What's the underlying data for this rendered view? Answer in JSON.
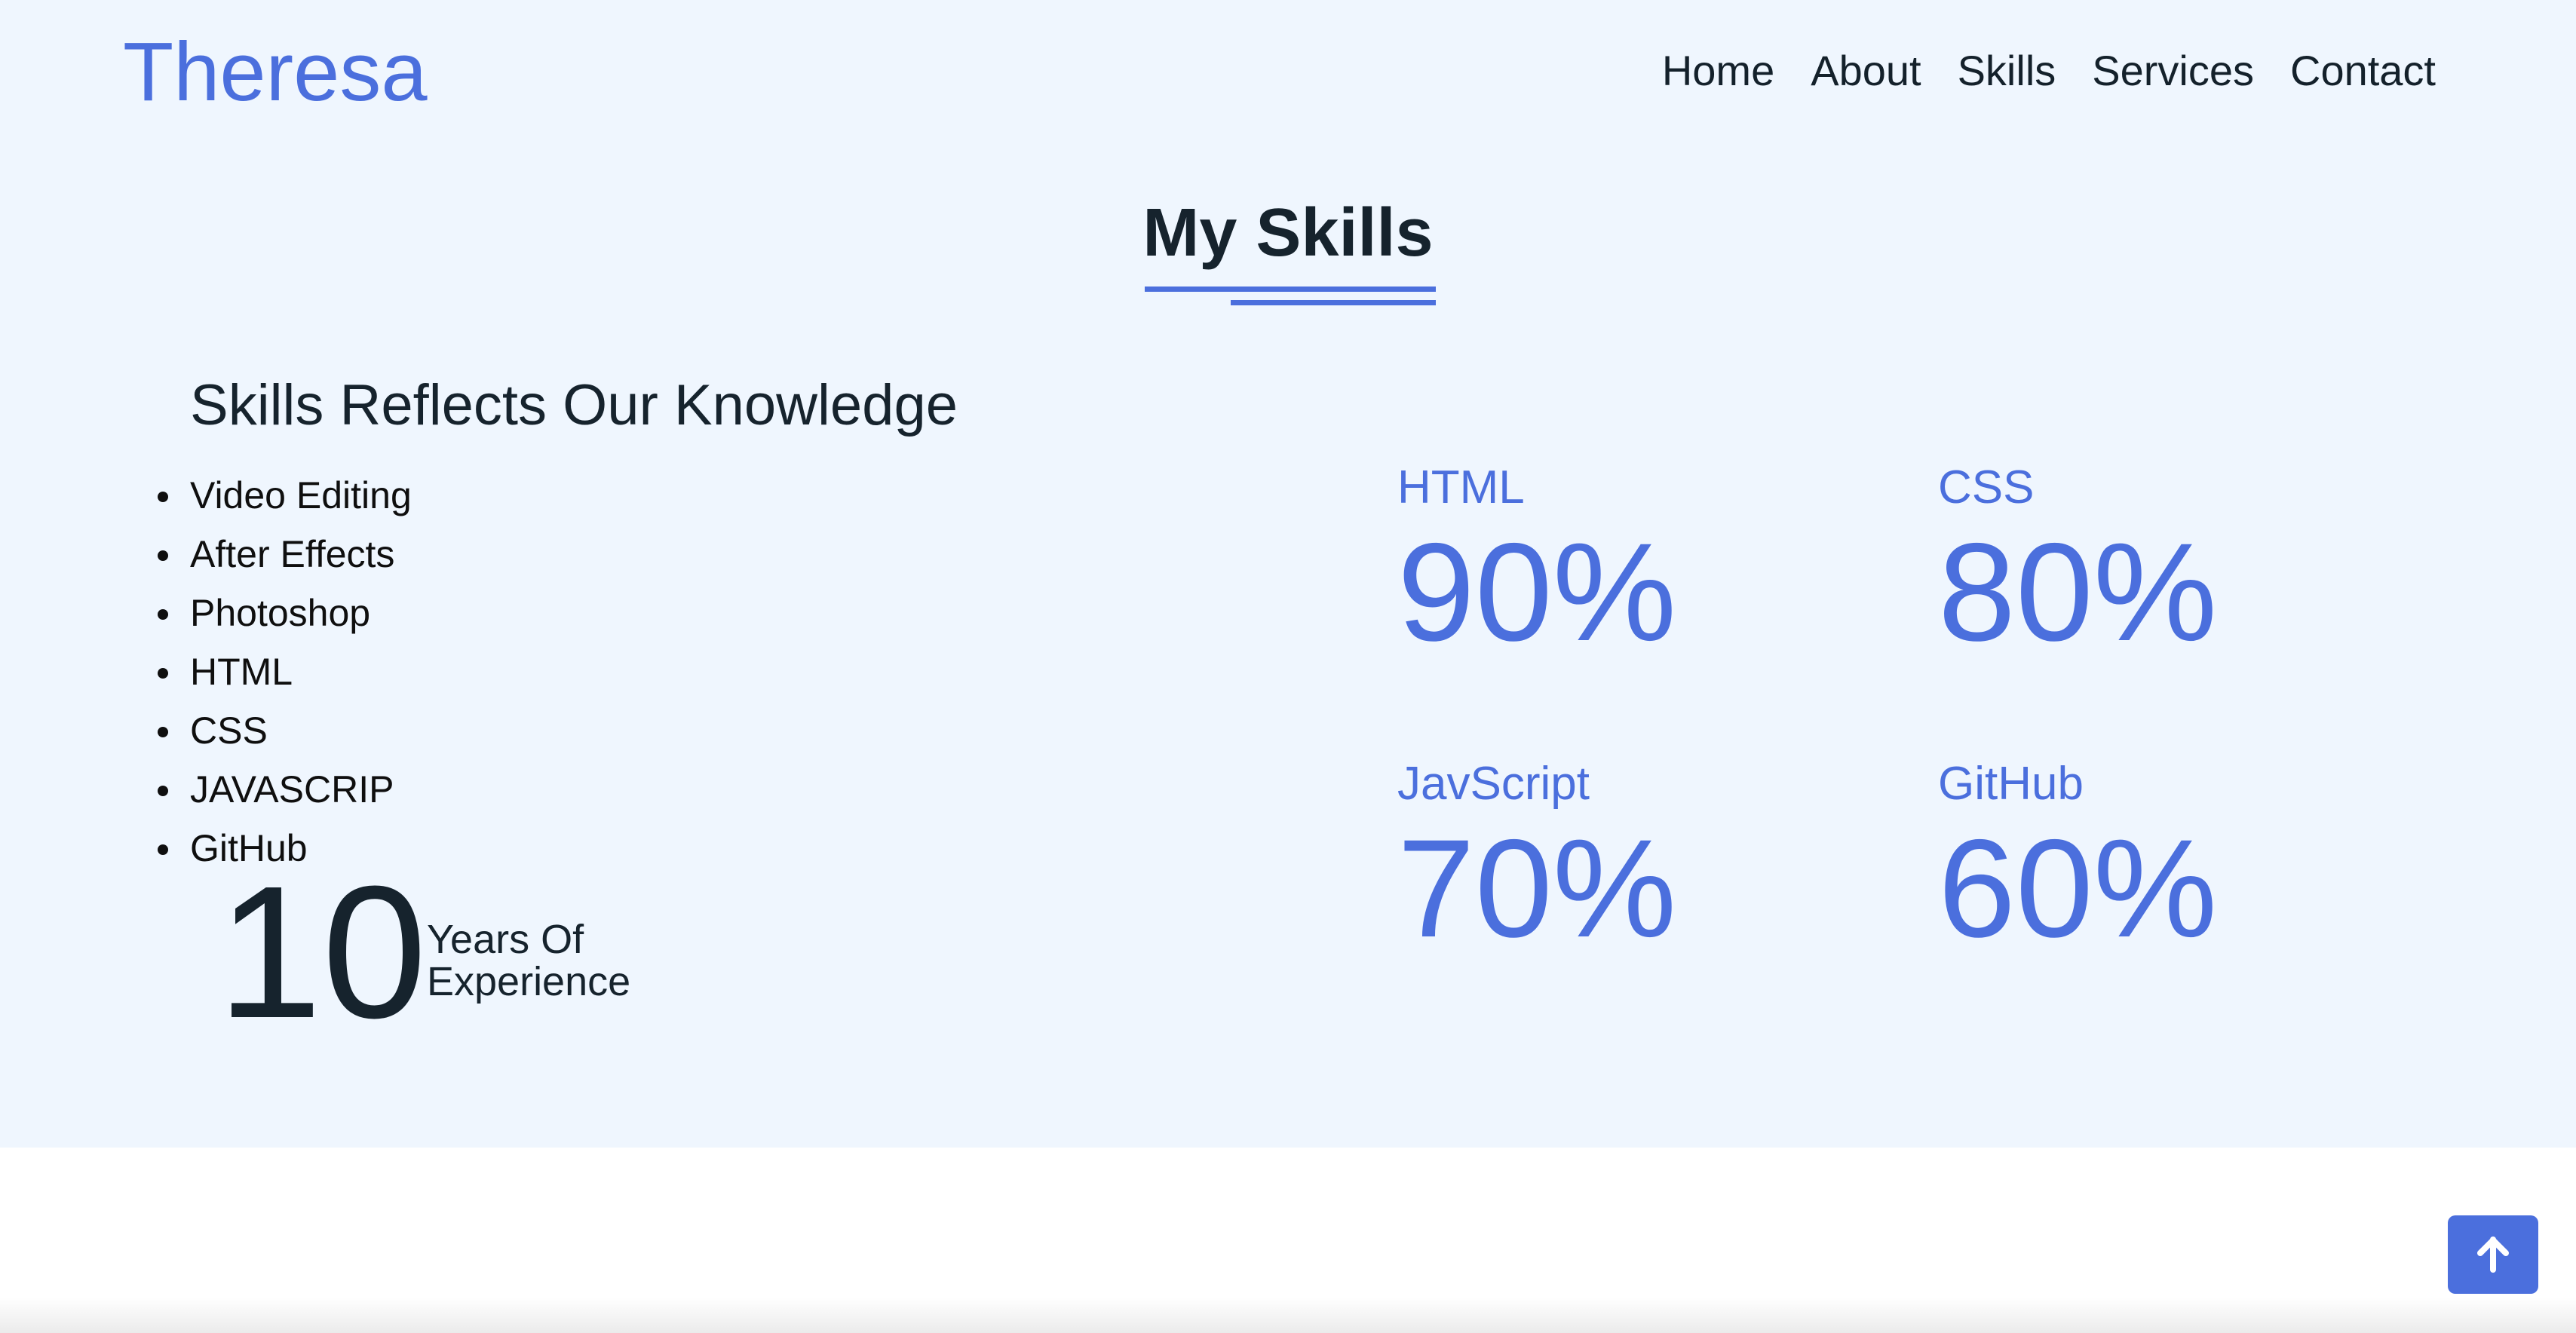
{
  "header": {
    "logo": "Theresa",
    "nav": [
      "Home",
      "About",
      "Skills",
      "Services",
      "Contact"
    ]
  },
  "skills_section": {
    "title": "My Skills",
    "subheading": "Skills Reflects Our Knowledge",
    "list": [
      "Video Editing",
      "After Effects",
      "Photoshop",
      "HTML",
      "CSS",
      "JAVASCRIP",
      "GitHub"
    ],
    "experience": {
      "number": "10",
      "line1": "Years Of",
      "line2": "Experience"
    },
    "stats": [
      {
        "label": "HTML",
        "value": "90%"
      },
      {
        "label": "CSS",
        "value": "80%"
      },
      {
        "label": "JavScript",
        "value": "70%"
      },
      {
        "label": "GitHub",
        "value": "60%"
      }
    ]
  },
  "scroll_top": {
    "icon": "arrow-up-icon"
  },
  "colors": {
    "accent": "#4b6fdd",
    "hero_background": "#eff6fe",
    "text_dark": "#16232d"
  }
}
